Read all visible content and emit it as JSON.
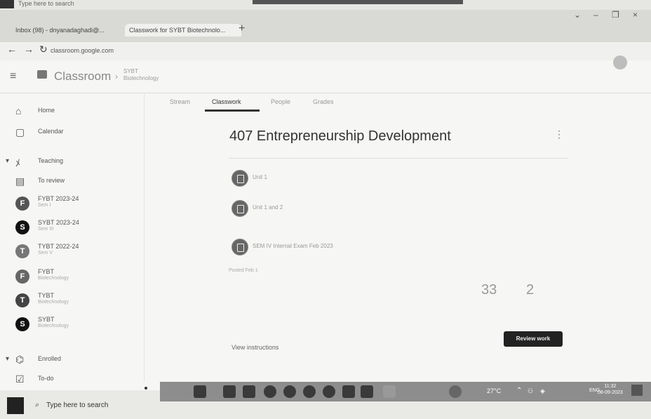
{
  "os": {
    "top_search": "Type here to search",
    "search_placeholder": "Type here to search",
    "weather": "27°C",
    "lang": "ENG",
    "time": "11:32",
    "date": "08-09-2023"
  },
  "browser": {
    "tabs": [
      {
        "label": "Inbox (98) - dnyanadaghadi@..."
      },
      {
        "label": "Classwork for SYBT Biotechnolo..."
      }
    ],
    "new_tab": "+",
    "url": "classroom.google.com",
    "window_controls": {
      "minimize": "–",
      "restore": "❐",
      "close": "×",
      "dropdown": "⌄"
    }
  },
  "app": {
    "name": "Classroom",
    "breadcrumb_class": "SYBT",
    "breadcrumb_sub": "Biotechnology",
    "nav_tabs": [
      "Stream",
      "Classwork",
      "People",
      "Grades"
    ]
  },
  "sidebar": {
    "items": [
      {
        "label": "Home",
        "icon": "home-icon"
      },
      {
        "label": "Calendar",
        "icon": "calendar-icon"
      },
      {
        "label": "Teaching",
        "icon": "people-icon"
      },
      {
        "label": "To review",
        "icon": "review-icon"
      }
    ],
    "classes": [
      {
        "initial": "F",
        "name": "FYBT 2023-24",
        "sub": "Sem I"
      },
      {
        "initial": "S",
        "name": "SYBT 2023-24",
        "sub": "Sem III"
      },
      {
        "initial": "T",
        "name": "TYBT 2022-24",
        "sub": "Sem V"
      },
      {
        "initial": "F",
        "name": "FYBT",
        "sub": "Biotechnology"
      },
      {
        "initial": "T",
        "name": "TYBT",
        "sub": "Biotechnology"
      },
      {
        "initial": "S",
        "name": "SYBT",
        "sub": "Biotechnology"
      }
    ],
    "enrolled": "Enrolled",
    "todo": "To-do"
  },
  "main": {
    "topic_title": "407 Entrepreneurship Development",
    "materials": [
      {
        "label": "Unit 1"
      },
      {
        "label": "Unit 1 and 2"
      },
      {
        "label": "SEM IV Internal Exam Feb 2023"
      }
    ],
    "posted": "Posted Feb 1",
    "turned_in": "33",
    "assigned": "2",
    "review_button": "Review work",
    "view_instructions": "View instructions"
  }
}
